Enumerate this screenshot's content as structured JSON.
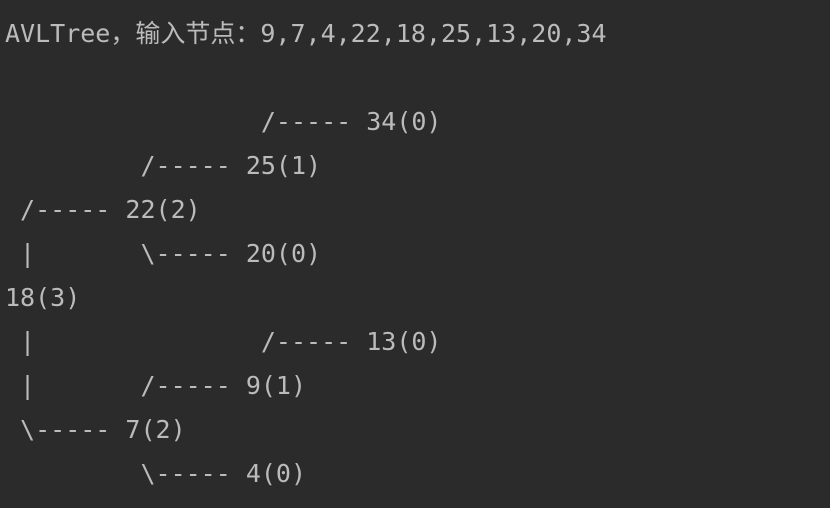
{
  "console": {
    "background_color": "#2b2b2b",
    "text_color": "#bbbbbb",
    "lines": [
      "AVLTree，输入节点：9,7,4,22,18,25,13,20,34",
      "",
      "                 /----- 34(0)",
      "         /----- 25(1)",
      " /----- 22(2)",
      " |       \\----- 20(0)",
      "18(3)",
      " |               /----- 13(0)",
      " |       /----- 9(1)",
      " \\----- 7(2)",
      "         \\----- 4(0)"
    ]
  }
}
